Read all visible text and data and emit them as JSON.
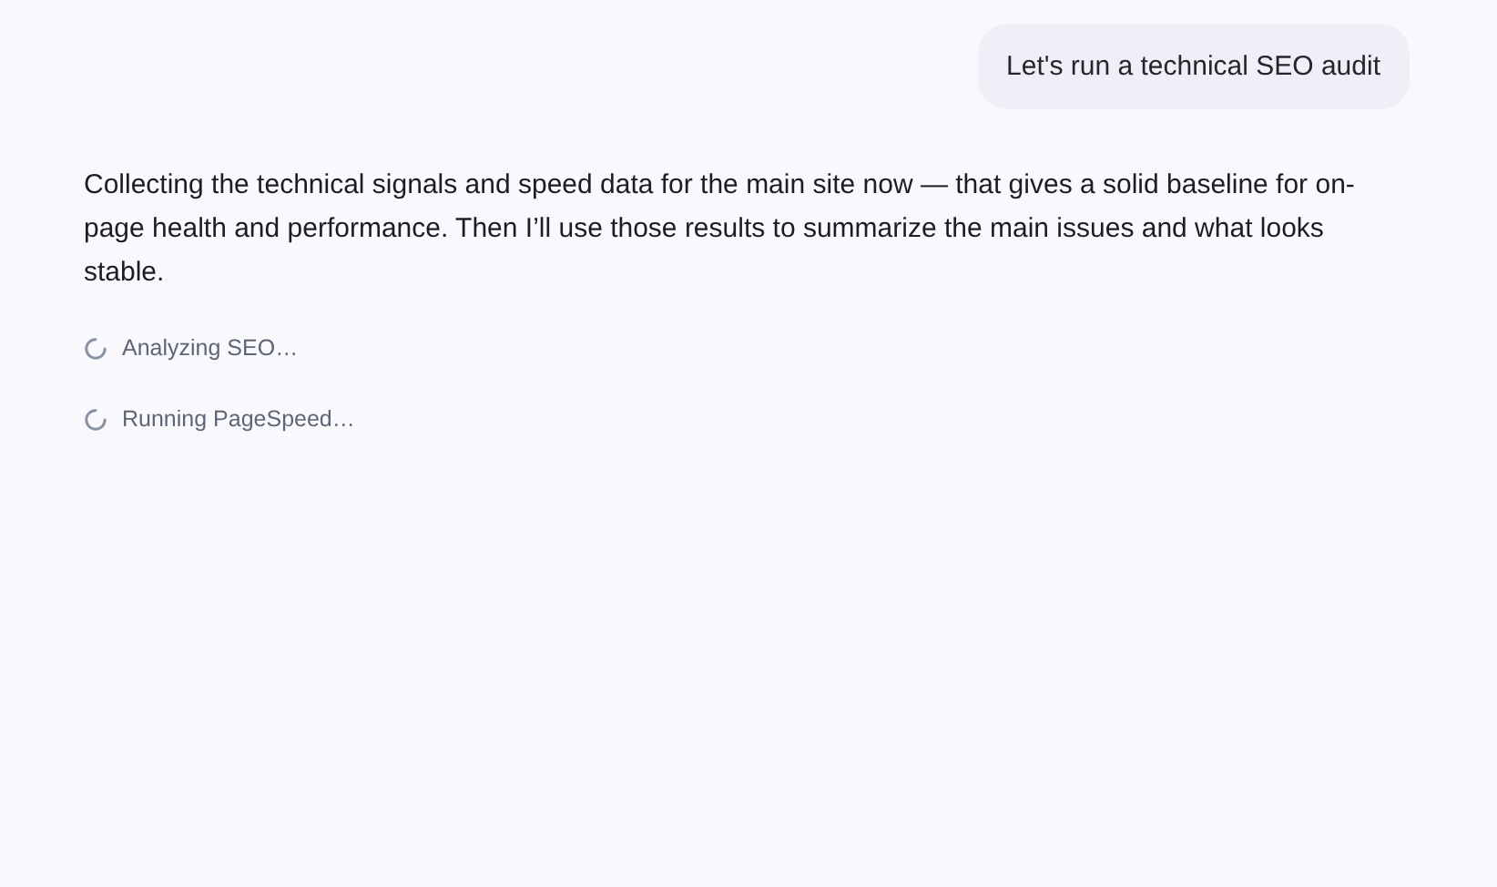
{
  "user_message": {
    "text": "Let's run a technical SEO audit"
  },
  "assistant_message": {
    "text": "Collecting the technical signals and speed data for the main site now — that gives a solid baseline for on-page health and performance. Then I’ll use those results to summarize the main issues and what looks stable."
  },
  "tool_steps": [
    {
      "label": "Analyzing SEO…",
      "kind": "loading"
    },
    {
      "label": "Running PageSpeed…",
      "kind": "loading"
    }
  ]
}
